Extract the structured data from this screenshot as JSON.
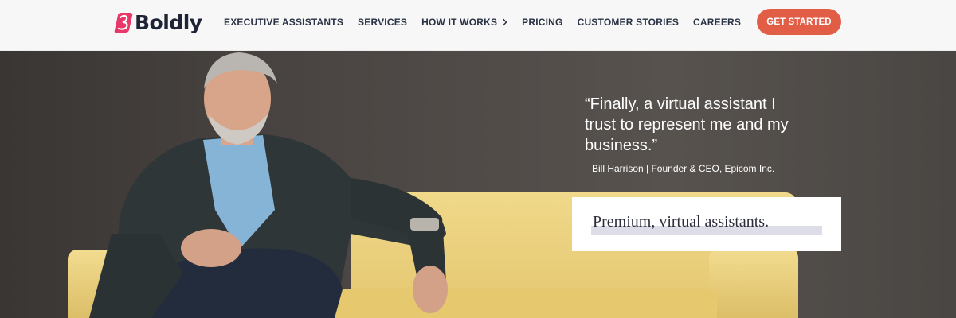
{
  "brand": {
    "name": "Boldly",
    "accent_color": "#e15d45",
    "logo_icon": "boldly-b-icon"
  },
  "nav": {
    "items": [
      {
        "label": "EXECUTIVE ASSISTANTS"
      },
      {
        "label": "SERVICES"
      },
      {
        "label": "HOW IT WORKS",
        "icon": "chevron-right-icon"
      },
      {
        "label": "PRICING"
      },
      {
        "label": "CUSTOMER STORIES"
      },
      {
        "label": "CAREERS"
      }
    ],
    "cta_label": "GET STARTED"
  },
  "hero": {
    "quote": "“Finally, a virtual assistant I\n trust to represent me and my\n business.”",
    "attribution": "Bill Harrison | Founder & CEO, Epicom Inc.",
    "tagline": "Premium, virtual assistants."
  }
}
